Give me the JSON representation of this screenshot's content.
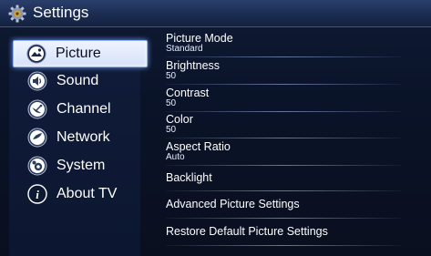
{
  "window": {
    "title": "Settings"
  },
  "left_menu": [
    {
      "label": "Picture",
      "icon": "picture-icon",
      "selected": true
    },
    {
      "label": "Sound",
      "icon": "speaker-icon",
      "selected": false
    },
    {
      "label": "Channel",
      "icon": "satellite-dish-icon",
      "selected": false
    },
    {
      "label": "Network",
      "icon": "network-globe-icon",
      "selected": false
    },
    {
      "label": "System",
      "icon": "system-gear-icon",
      "selected": false
    },
    {
      "label": "About TV",
      "icon": "info-icon",
      "selected": false
    }
  ],
  "picture_settings": [
    {
      "name": "Picture Mode",
      "value": "Standard"
    },
    {
      "name": "Brightness",
      "value": "50"
    },
    {
      "name": "Contrast",
      "value": "50"
    },
    {
      "name": "Color",
      "value": "50"
    },
    {
      "name": "Aspect Ratio",
      "value": "Auto"
    },
    {
      "name": "Backlight"
    },
    {
      "name": "Advanced Picture Settings"
    },
    {
      "name": "Restore Default Picture Settings"
    }
  ],
  "colors": {
    "title_bar": "#1b2c52",
    "selected_item_bg": "#eef3ff",
    "selected_glow": "#8fb1ff",
    "background": "#0a1328"
  }
}
